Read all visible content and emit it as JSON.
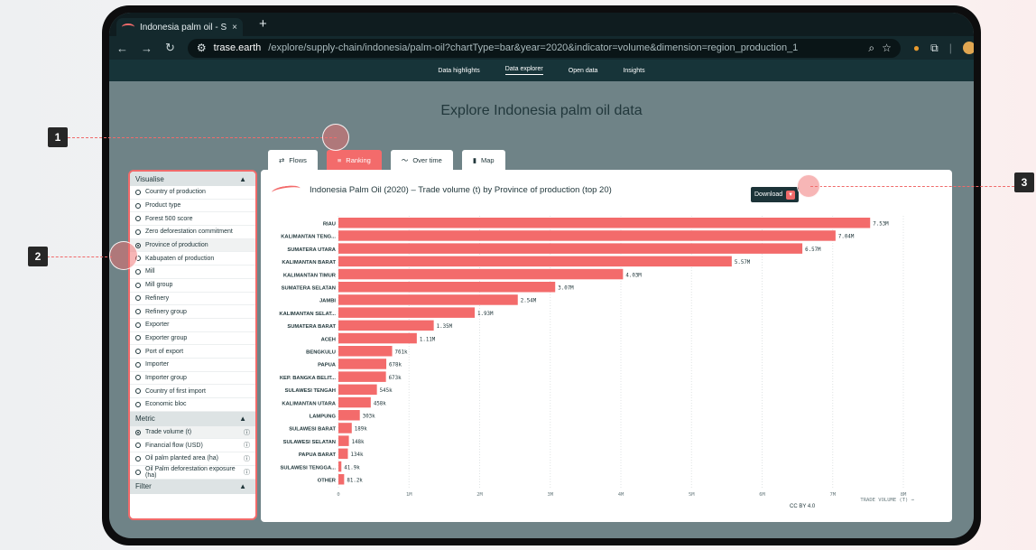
{
  "browser": {
    "tab_title": "Indonesia palm oil - Supply c",
    "close_glyph": "×",
    "new_tab_glyph": "+",
    "url_domain": "trase.earth",
    "url_path": "/explore/supply-chain/indonesia/palm-oil?chartType=bar&year=2020&indicator=volume&dimension=region_production_1"
  },
  "site_nav": [
    "Data highlights",
    "Data explorer",
    "Open data",
    "Insights"
  ],
  "page_title": "Explore Indonesia palm oil data",
  "modes": [
    "Flows",
    "Ranking",
    "Over time",
    "Map"
  ],
  "sidebar": {
    "visualise_label": "Visualise",
    "visualise_options": [
      "Country of production",
      "Product type",
      "Forest 500 score",
      "Zero deforestation commitment",
      "Province of production",
      "Kabupaten of production",
      "Mill",
      "Mill group",
      "Refinery",
      "Refinery group",
      "Exporter",
      "Exporter group",
      "Port of export",
      "Importer",
      "Importer group",
      "Country of first import",
      "Economic bloc"
    ],
    "selected_visualise": "Province of production",
    "metric_label": "Metric",
    "metric_options": [
      "Trade volume (t)",
      "Financial flow (USD)",
      "Oil palm planted area (ha)",
      "Oil Palm deforestation exposure (ha)"
    ],
    "selected_metric": "Trade volume (t)",
    "filter_label": "Filter"
  },
  "chart_header": {
    "title": "Indonesia Palm Oil (2020) – Trade volume (t) by Province of production (top 20)",
    "download_label": "Download"
  },
  "chart_data": {
    "type": "bar",
    "orientation": "horizontal",
    "title": "Indonesia Palm Oil (2020) – Trade volume (t) by Province of production (top 20)",
    "categories": [
      "RIAU",
      "KALIMANTAN TENG...",
      "SUMATERA UTARA",
      "KALIMANTAN BARAT",
      "KALIMANTAN TIMUR",
      "SUMATERA SELATAN",
      "JAMBI",
      "KALIMANTAN SELAT...",
      "SUMATERA BARAT",
      "ACEH",
      "BENGKULU",
      "PAPUA",
      "KEP. BANGKA BELIT...",
      "SULAWESI TENGAH",
      "KALIMANTAN UTARA",
      "LAMPUNG",
      "SULAWESI BARAT",
      "SULAWESI SELATAN",
      "PAPUA BARAT",
      "SULAWESI TENGGA...",
      "OTHER"
    ],
    "values": [
      7530000,
      7040000,
      6570000,
      5570000,
      4030000,
      3070000,
      2540000,
      1930000,
      1350000,
      1110000,
      761000,
      678000,
      673000,
      545000,
      458000,
      303000,
      189000,
      148000,
      134000,
      41900,
      81200
    ],
    "value_labels": [
      "7.53M",
      "7.04M",
      "6.57M",
      "5.57M",
      "4.03M",
      "3.07M",
      "2.54M",
      "1.93M",
      "1.35M",
      "1.11M",
      "761k",
      "678k",
      "673k",
      "545k",
      "458k",
      "303k",
      "189k",
      "148k",
      "134k",
      "41.9k",
      "81.2k"
    ],
    "xlim": [
      0,
      8000000
    ],
    "x_ticks": [
      0,
      1000000,
      2000000,
      3000000,
      4000000,
      5000000,
      6000000,
      7000000,
      8000000
    ],
    "x_tick_labels": [
      "0",
      "1M",
      "2M",
      "3M",
      "4M",
      "5M",
      "6M",
      "7M",
      "8M"
    ],
    "xlabel": "TRADE VOLUME (T) →",
    "bar_color": "#f36b6b",
    "grid": "vertical dotted",
    "credit": "CC BY 4.0"
  },
  "callouts": [
    "1",
    "2",
    "3"
  ],
  "colors": {
    "accent": "#f36b6b",
    "dark": "#1c3338",
    "page_bg": "#6f8387"
  }
}
